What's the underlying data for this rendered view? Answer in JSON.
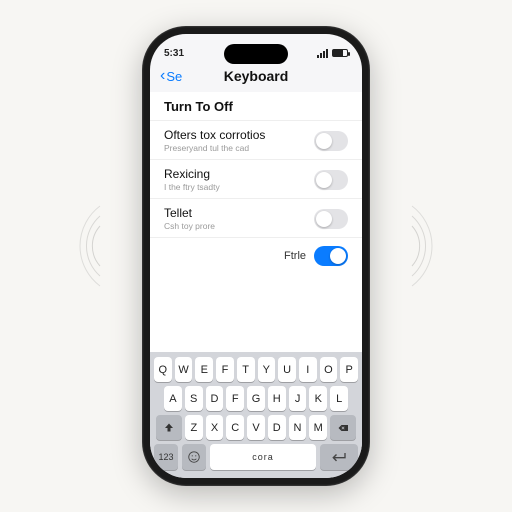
{
  "status": {
    "time": "5:31"
  },
  "nav": {
    "back": "Se",
    "title": "Keyboard"
  },
  "rows": [
    {
      "label": "Turn To Off",
      "sub": ""
    },
    {
      "label": "Ofters tox corrotios",
      "sub": "Preseryand tul the cad"
    },
    {
      "label": "Rexicing",
      "sub": "I the ftry tsadty"
    },
    {
      "label": "Tellet",
      "sub": "Csh toy prore"
    }
  ],
  "lastToggle": {
    "label": "Ftrle"
  },
  "keyboard": {
    "r1": [
      "q",
      "w",
      "e",
      "f",
      "t",
      "y",
      "u",
      "i",
      "o",
      "p"
    ],
    "r2": [
      "a",
      "s",
      "d",
      "f",
      "g",
      "h",
      "j",
      "k",
      "l"
    ],
    "r3": [
      "z",
      "x",
      "c",
      "v",
      "d",
      "n",
      "m"
    ],
    "space": "cora"
  }
}
